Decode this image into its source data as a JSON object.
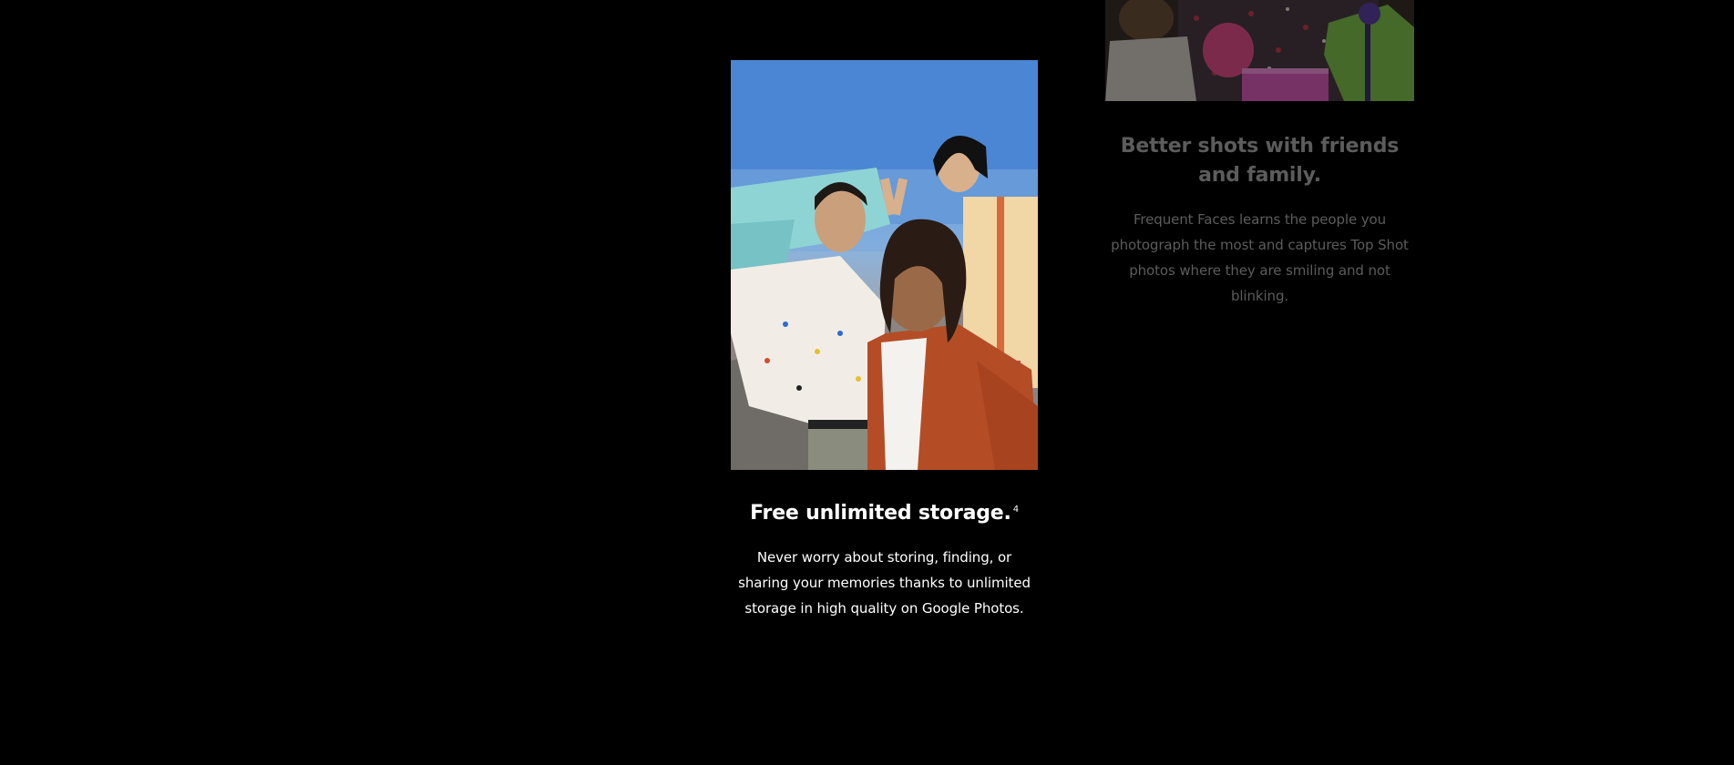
{
  "features": {
    "storage": {
      "title": "Free unlimited storage.",
      "footnote": "4",
      "body": "Never worry about storing, finding, or sharing your memories thanks to unlimited storage in high quality on Google Photos.",
      "image_icon": "group-selfie-photo"
    },
    "friends": {
      "title": "Better shots with friends and family.",
      "body": "Frequent Faces learns the people you photograph the most and captures Top Shot photos where they are smiling and not blinking.",
      "image_icon": "family-gifts-photo"
    }
  },
  "colors": {
    "background": "#000000",
    "text_active": "#ffffff",
    "text_dimmed": "#5c5c5c"
  }
}
